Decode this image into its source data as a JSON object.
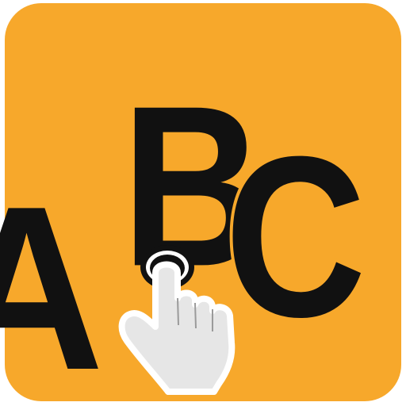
{
  "icon": {
    "letters": {
      "a": "A",
      "b": "B",
      "c": "C"
    },
    "pointer_icon": "hand-pointer-tap-icon"
  },
  "colors": {
    "tile_background": "#F7A82B",
    "letters": "#111111",
    "letter_outline": "#FFFFFF",
    "hand_fill": "#E6E6E6",
    "hand_outline": "#FFFFFF",
    "tap_ring": "#111111",
    "tap_ring_inner": "#FFFFFF"
  }
}
